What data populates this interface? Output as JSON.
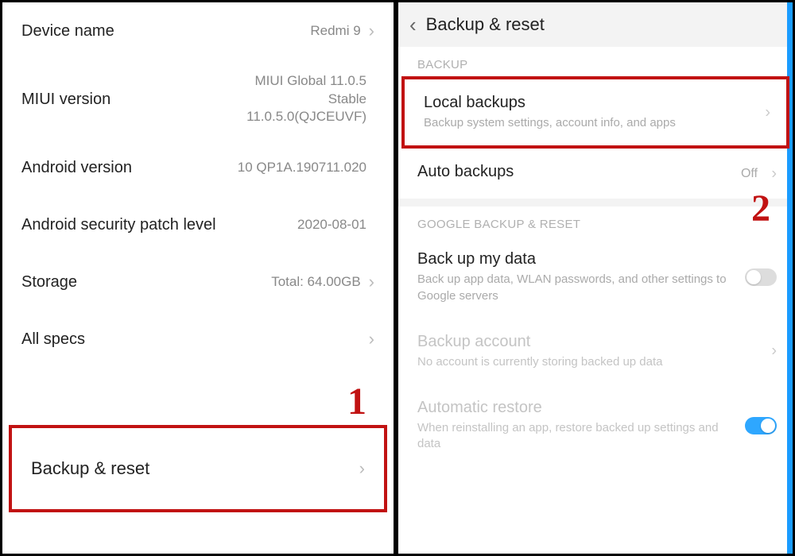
{
  "left": {
    "rows": [
      {
        "label": "Device name",
        "value": "Redmi 9"
      },
      {
        "label": "MIUI version",
        "value": "MIUI Global 11.0.5\nStable\n11.0.5.0(QJCEUVF)"
      },
      {
        "label": "Android version",
        "value": "10 QP1A.190711.020"
      },
      {
        "label": "Android security patch level",
        "value": "2020-08-01"
      },
      {
        "label": "Storage",
        "value": "Total: 64.00GB"
      },
      {
        "label": "All specs",
        "value": ""
      },
      {
        "label": "Backup & reset",
        "value": ""
      }
    ],
    "marker": "1"
  },
  "right": {
    "header": "Backup & reset",
    "section1": "BACKUP",
    "local": {
      "title": "Local backups",
      "sub": "Backup system settings, account info, and apps"
    },
    "auto": {
      "title": "Auto backups",
      "status": "Off"
    },
    "section2": "GOOGLE BACKUP & RESET",
    "gback": {
      "title": "Back up my data",
      "sub": "Back up app data, WLAN passwords, and other settings to Google servers"
    },
    "bacct": {
      "title": "Backup account",
      "sub": "No account is currently storing backed up data"
    },
    "arestore": {
      "title": "Automatic restore",
      "sub": "When reinstalling an app, restore backed up settings and data"
    },
    "marker": "2"
  }
}
